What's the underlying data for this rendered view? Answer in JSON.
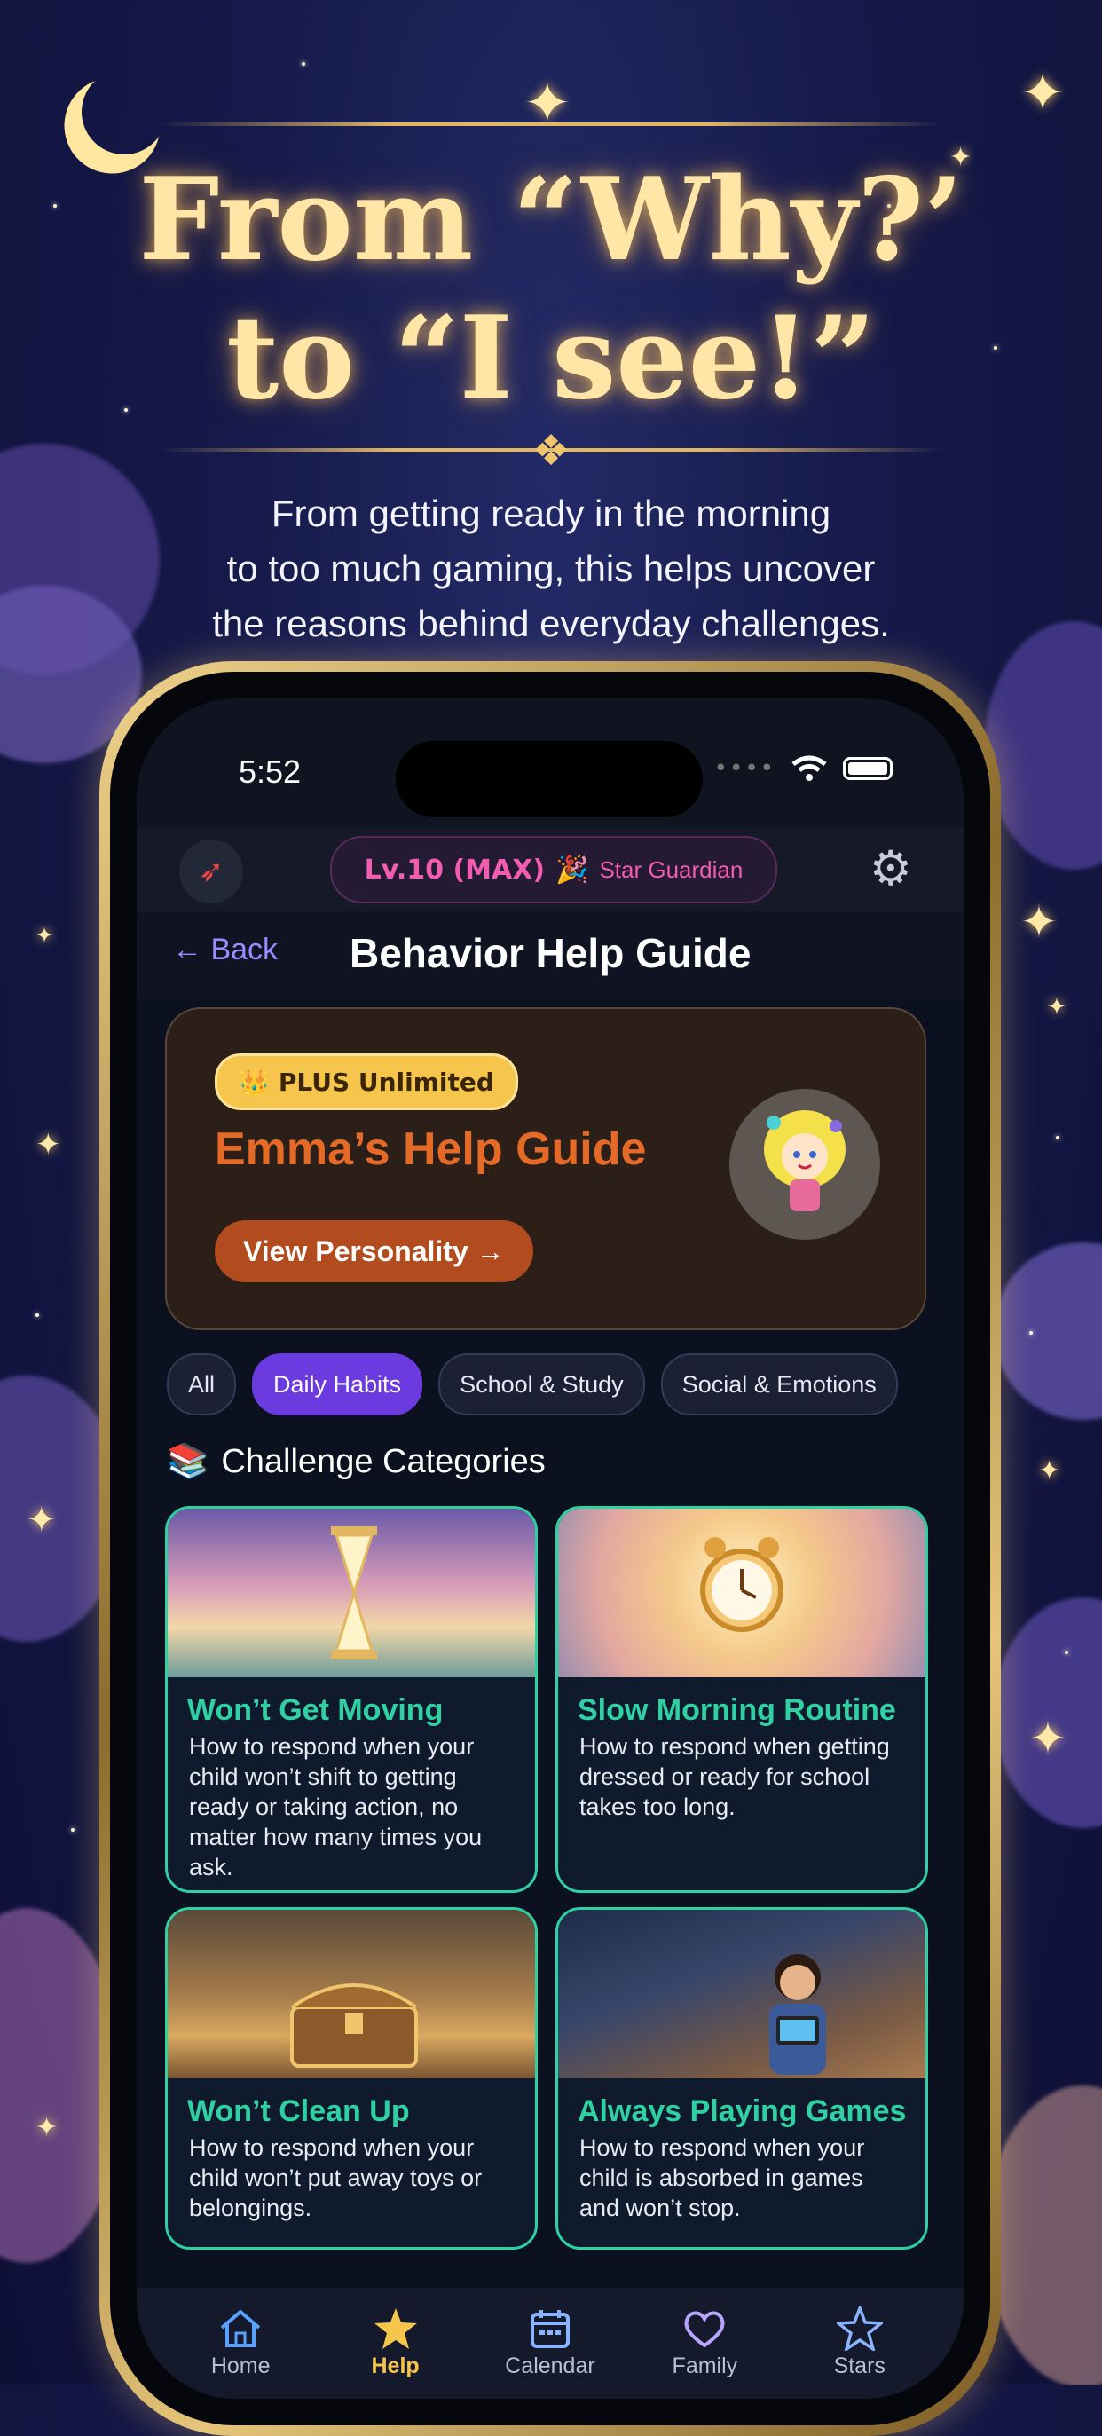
{
  "promo": {
    "headline_line1": "From “Why?’",
    "headline_line2": "to “I see!”",
    "subtitle_line1": "From getting ready in the morning",
    "subtitle_line2": "to too much gaming, this helps uncover",
    "subtitle_line3": "the reasons behind everyday challenges."
  },
  "status_bar": {
    "time": "5:52"
  },
  "top_bar": {
    "level": "Lv.10 (MAX)",
    "level_emoji": "🎉",
    "rank": "Star Guardian"
  },
  "nav": {
    "back_label": "← Back",
    "title": "Behavior Help Guide"
  },
  "hero": {
    "badge_icon": "👑",
    "badge_label": "PLUS Unlimited",
    "guide_title": "Emma’s Help Guide",
    "cta_label": "View Personality →"
  },
  "filters": [
    {
      "label": "All",
      "active": false
    },
    {
      "label": "Daily Habits",
      "active": true
    },
    {
      "label": "School & Study",
      "active": false
    },
    {
      "label": "Social & Emotions",
      "active": false
    }
  ],
  "section": {
    "icon": "📚",
    "title": "Challenge Categories"
  },
  "categories": [
    {
      "title": "Won’t Get Moving",
      "description": "How to respond when your child won’t shift to getting ready or taking action, no matter how many times you ask."
    },
    {
      "title": "Slow Morning Routine",
      "description": "How to respond when getting dressed or ready for school takes too long."
    },
    {
      "title": "Won’t Clean Up",
      "description": "How to respond when your child won’t put away toys or belongings."
    },
    {
      "title": "Always Playing Games",
      "description": "How to respond when your child is absorbed in games and won’t stop."
    }
  ],
  "tabs": [
    {
      "label": "Home",
      "icon": "home-icon"
    },
    {
      "label": "Help",
      "icon": "star-icon"
    },
    {
      "label": "Calendar",
      "icon": "calendar-icon"
    },
    {
      "label": "Family",
      "icon": "heart-icon"
    },
    {
      "label": "Stars",
      "icon": "star-outline-icon"
    }
  ],
  "colors": {
    "accent_purple": "#6b3be0",
    "tile_border": "#2fd1a2",
    "gold": "#f6c64c",
    "pink": "#f25db2",
    "guide_orange": "#e56a27"
  }
}
